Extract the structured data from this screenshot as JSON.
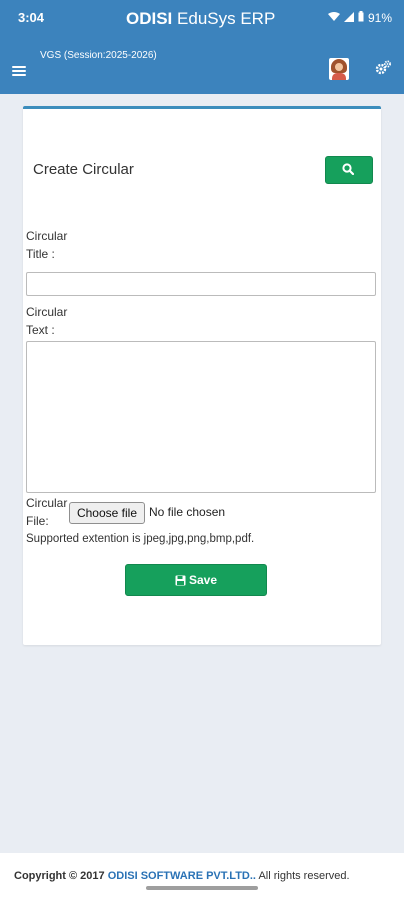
{
  "status_bar": {
    "time": "3:04",
    "battery": "91%"
  },
  "header": {
    "brand_bold": "ODISI",
    "brand_rest": " EduSys ERP",
    "session": "VGS (Session:2025-2026)"
  },
  "icons": {
    "menu": "menu-icon",
    "avatar": "avatar",
    "settings": "gears-icon",
    "search": "search-icon",
    "save": "floppy-disk-icon"
  },
  "colors": {
    "header_bg": "#3c83bd",
    "accent_green": "#16a05c",
    "card_border": "#3c8dbc",
    "brand_link": "#2a72b5"
  },
  "form": {
    "title": "Create Circular",
    "circular_title_label_1": "Circular",
    "circular_title_label_2": "Title :",
    "circular_title_value": "",
    "circular_text_label_1": "Circular",
    "circular_text_label_2": "Text :",
    "circular_text_value": "",
    "circular_file_label_1": "Circular",
    "circular_file_label_2": "File:",
    "choose_file_label": "Choose file",
    "file_status": "No file chosen",
    "supported_note": "Supported extention is jpeg,jpg,png,bmp,pdf.",
    "save_label": "Save"
  },
  "footer": {
    "copyright_prefix": "Copyright © 2017 ",
    "company": "ODISI SOFTWARE PVT.LTD..",
    "rights": " All rights reserved."
  }
}
